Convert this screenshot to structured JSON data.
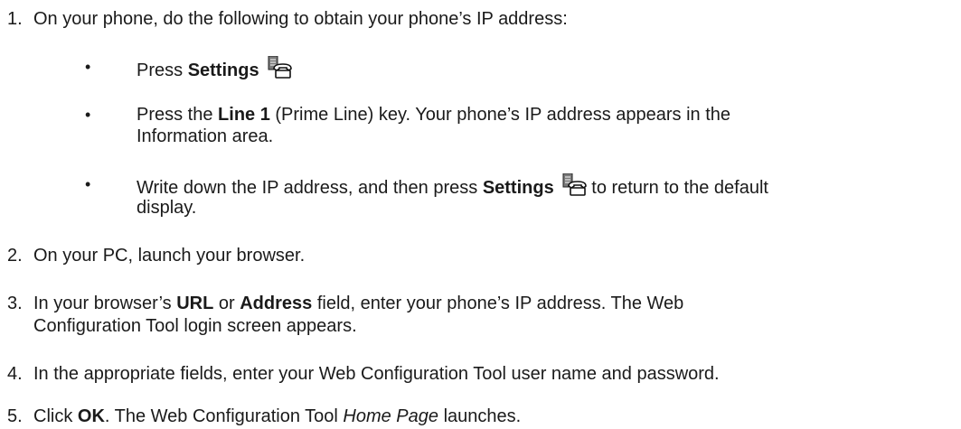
{
  "steps": [
    {
      "number": "1.",
      "text": "On your phone, do the following to obtain your phone’s IP address:",
      "bullets": [
        {
          "symbol": "•",
          "pre": "Press ",
          "bold": "Settings",
          "icon": "settings-phone-icon"
        },
        {
          "symbol": "•",
          "pre": "Press the ",
          "bold": "Line 1",
          "post_line1": " (Prime Line) key. Your phone’s IP address appears in the",
          "line2": "Information area."
        },
        {
          "symbol": "•",
          "pre": "Write down the IP address, and then press ",
          "bold": "Settings",
          "icon": "settings-phone-icon",
          "post_line1": " to return to the default",
          "line2": "display."
        }
      ]
    },
    {
      "number": "2.",
      "text": "On your PC, launch your browser."
    },
    {
      "number": "3.",
      "pre": "In your browser’s ",
      "bold1": "URL",
      "mid": " or ",
      "bold2": "Address",
      "post_line1": " field, enter your phone’s IP address. The Web",
      "line2": "Configuration Tool login screen appears."
    },
    {
      "number": "4.",
      "text": "In the appropriate fields, enter your Web Configuration Tool user name and password."
    },
    {
      "number": "5.",
      "pre": "Click ",
      "bold": "OK",
      "mid": ". The Web Configuration Tool ",
      "italic": "Home Page",
      "post": " launches."
    }
  ]
}
